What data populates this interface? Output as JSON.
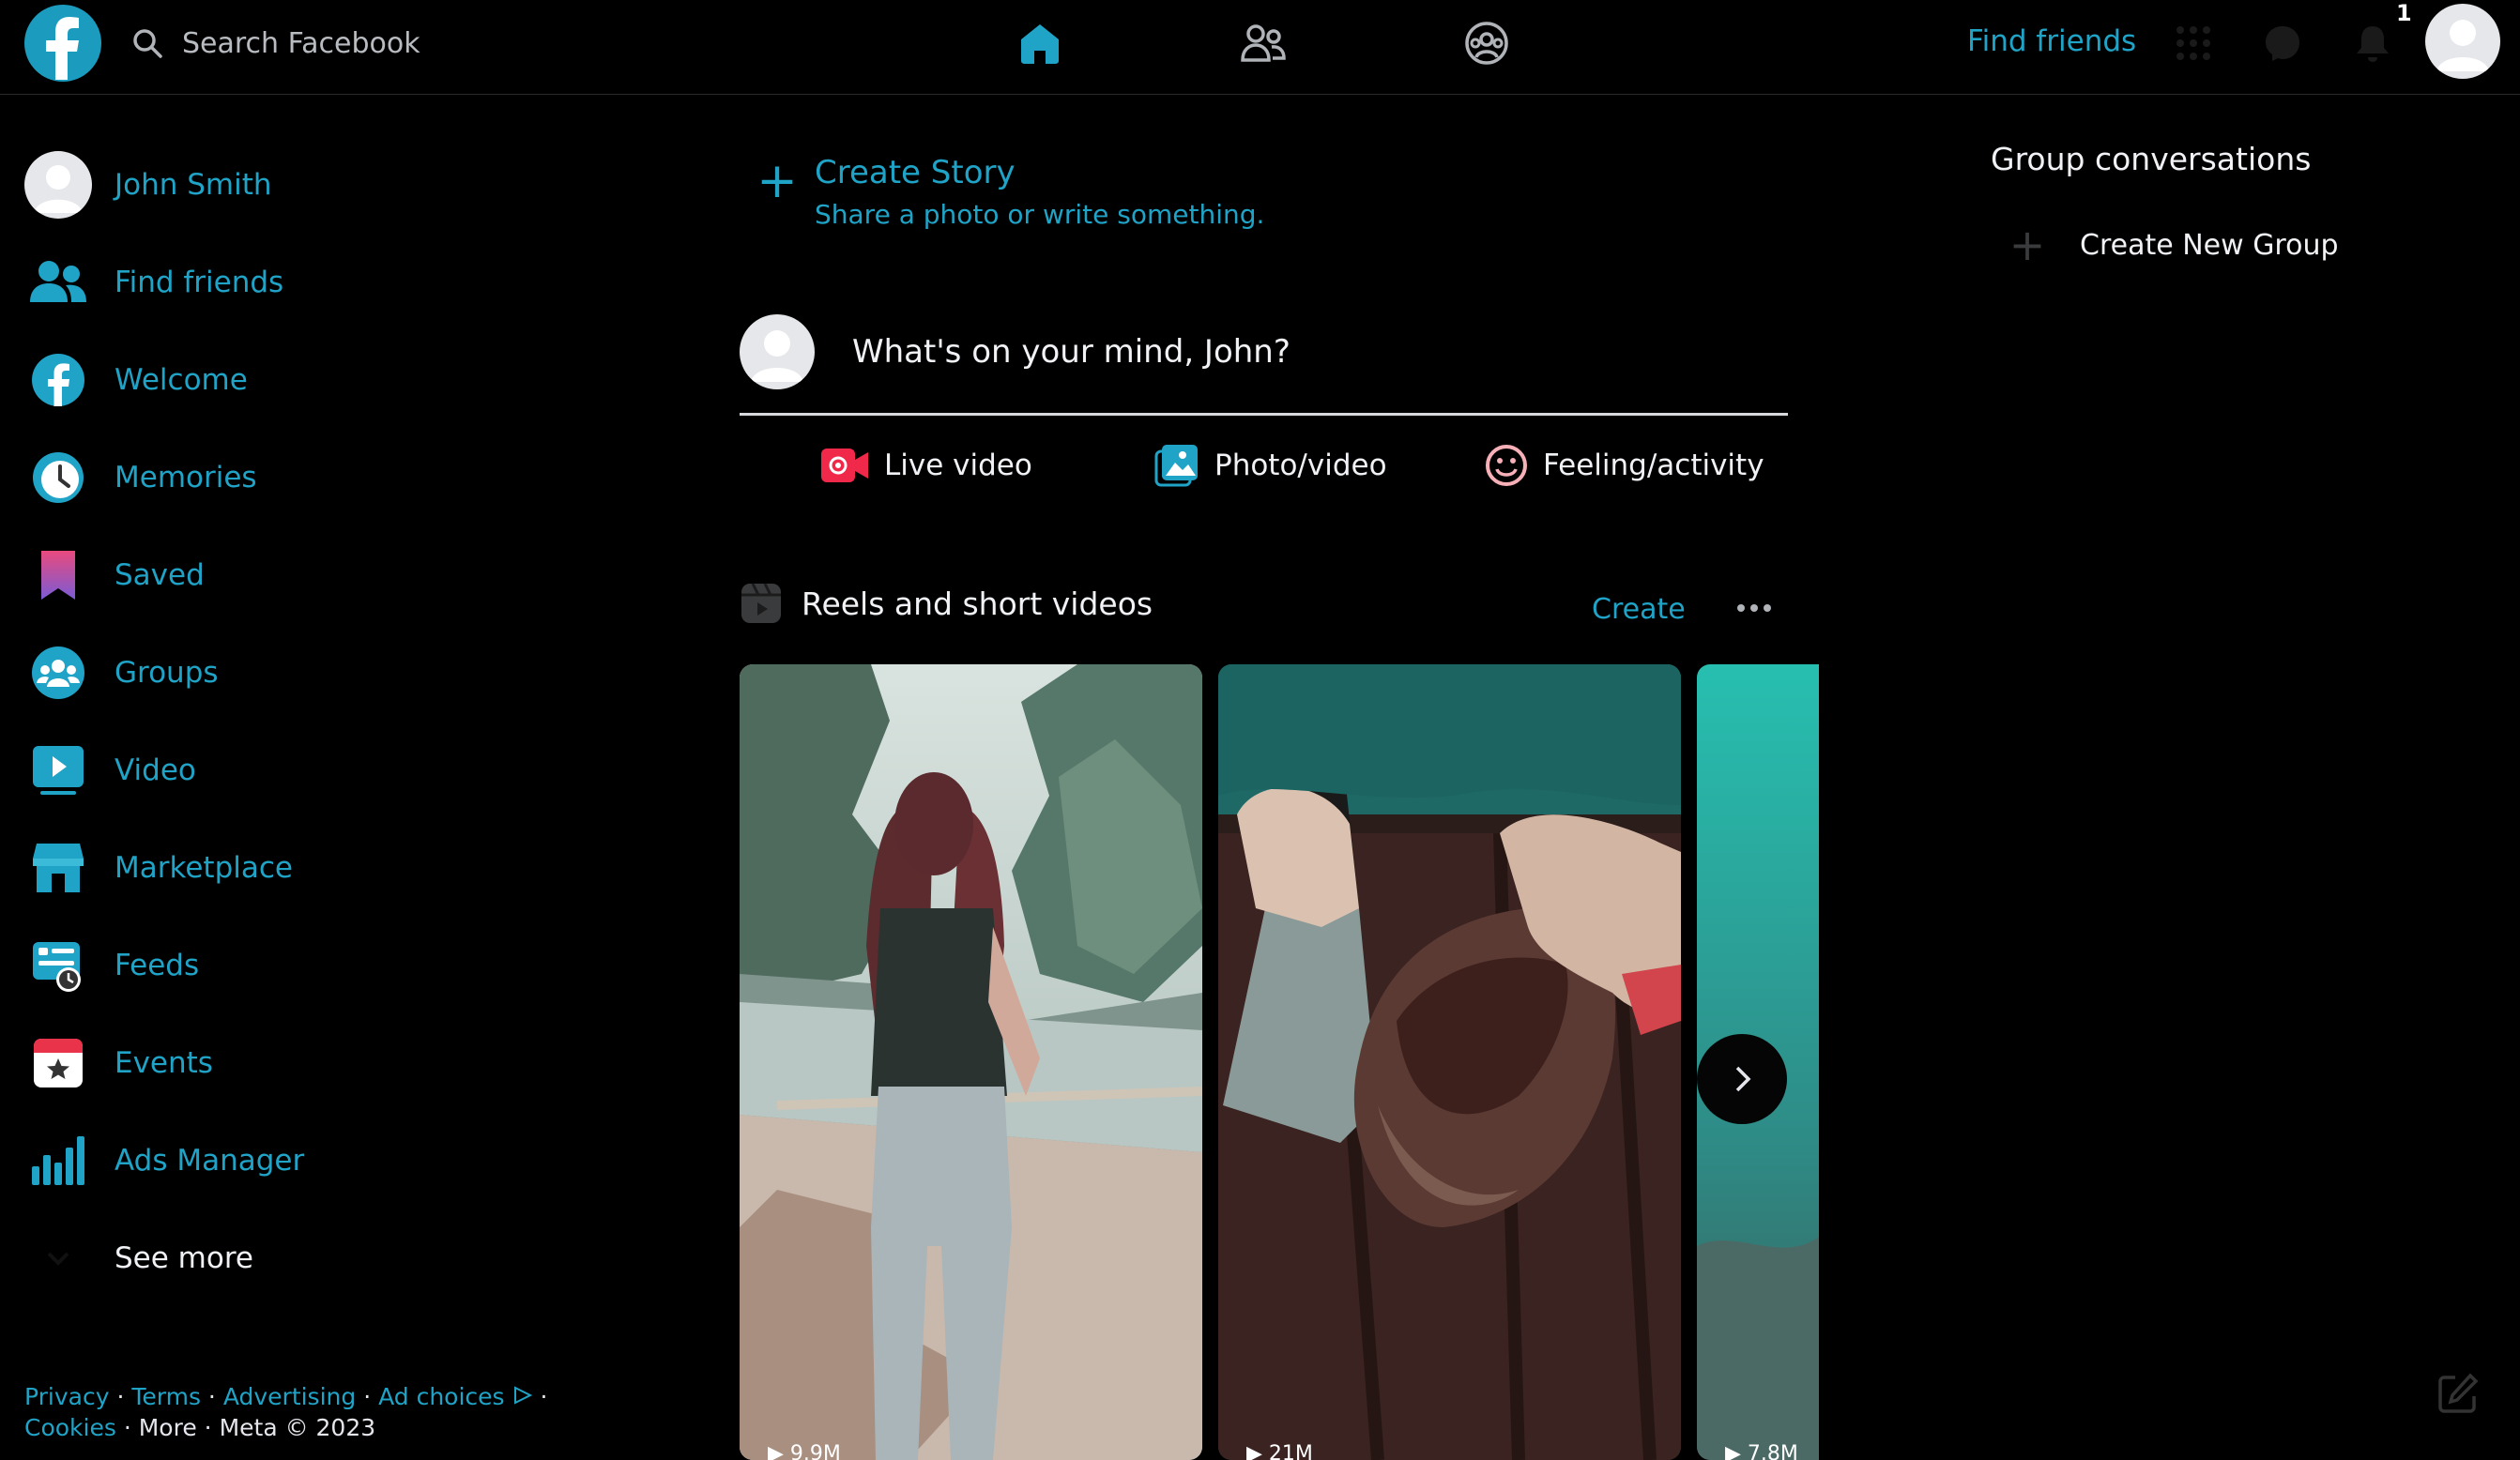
{
  "topbar": {
    "search_placeholder": "Search Facebook",
    "find_friends_label": "Find friends",
    "notification_count": "1",
    "nav_tabs": [
      "home-icon",
      "friends-icon",
      "groups-icon"
    ]
  },
  "sidebar": {
    "items": [
      {
        "label": "John Smith",
        "icon": "avatar"
      },
      {
        "label": "Find friends",
        "icon": "friends-icon"
      },
      {
        "label": "Welcome",
        "icon": "facebook-icon"
      },
      {
        "label": "Memories",
        "icon": "clock-icon"
      },
      {
        "label": "Saved",
        "icon": "bookmark-icon"
      },
      {
        "label": "Groups",
        "icon": "groups-icon"
      },
      {
        "label": "Video",
        "icon": "video-icon"
      },
      {
        "label": "Marketplace",
        "icon": "shop-icon"
      },
      {
        "label": "Feeds",
        "icon": "feeds-icon"
      },
      {
        "label": "Events",
        "icon": "calendar-icon"
      },
      {
        "label": "Ads Manager",
        "icon": "bar-chart-icon"
      },
      {
        "label": "See more",
        "icon": "chevron-down-icon"
      }
    ],
    "footer": {
      "links": [
        "Privacy",
        "Terms",
        "Advertising",
        "Ad choices",
        "Cookies"
      ],
      "more": "More",
      "copyright": "Meta © 2023"
    }
  },
  "main": {
    "create_story": {
      "title": "Create Story",
      "subtitle": "Share a photo or write something."
    },
    "composer": {
      "prompt": "What's on your mind, John?"
    },
    "actions": [
      {
        "label": "Live video",
        "icon": "live-video-icon"
      },
      {
        "label": "Photo/video",
        "icon": "photo-icon"
      },
      {
        "label": "Feeling/activity",
        "icon": "smiley-icon"
      }
    ],
    "reels": {
      "title": "Reels and short videos",
      "create_label": "Create",
      "items": [
        {
          "views": "9.9M"
        },
        {
          "views": "21M"
        },
        {
          "views": "7.8M"
        }
      ]
    }
  },
  "right": {
    "title": "Group conversations",
    "create_group_label": "Create New Group"
  },
  "colors": {
    "accent": "#1fa3c7",
    "background": "#000000",
    "text": "#f0f2f5"
  }
}
